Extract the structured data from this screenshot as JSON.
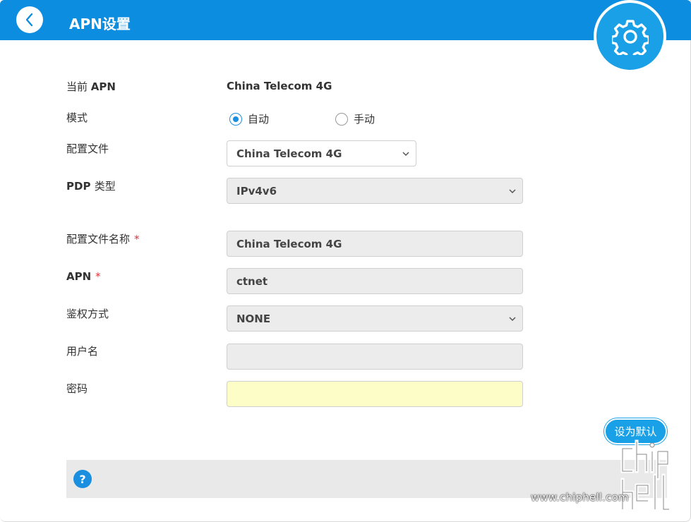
{
  "header": {
    "title": "APN设置",
    "back_icon": "chevron-left-icon",
    "settings_icon": "gear-icon",
    "accent": "#0d8de0"
  },
  "form": {
    "current_apn": {
      "label_prefix": "当前",
      "label_suffix": "APN",
      "value": "China Telecom 4G"
    },
    "mode": {
      "label": "模式",
      "options": [
        {
          "label": "自动",
          "checked": true
        },
        {
          "label": "手动",
          "checked": false
        }
      ]
    },
    "profile": {
      "label": "配置文件",
      "value": "China Telecom 4G"
    },
    "pdp_type": {
      "label_prefix": "PDP",
      "label_suffix": "类型",
      "value": "IPv4v6"
    },
    "profile_name": {
      "label": "配置文件名称",
      "required_mark": "*",
      "value": "China Telecom 4G"
    },
    "apn": {
      "label": "APN",
      "required_mark": "*",
      "value": "ctnet"
    },
    "auth": {
      "label": "鉴权方式",
      "value": "NONE"
    },
    "username": {
      "label": "用户名",
      "value": ""
    },
    "password": {
      "label": "密码",
      "value": ""
    }
  },
  "actions": {
    "set_default_label": "设为默认"
  },
  "help": {
    "icon": "question-icon",
    "glyph": "?"
  },
  "watermark": {
    "url": "www.chiphell.com",
    "logo_text": "chiphell"
  }
}
